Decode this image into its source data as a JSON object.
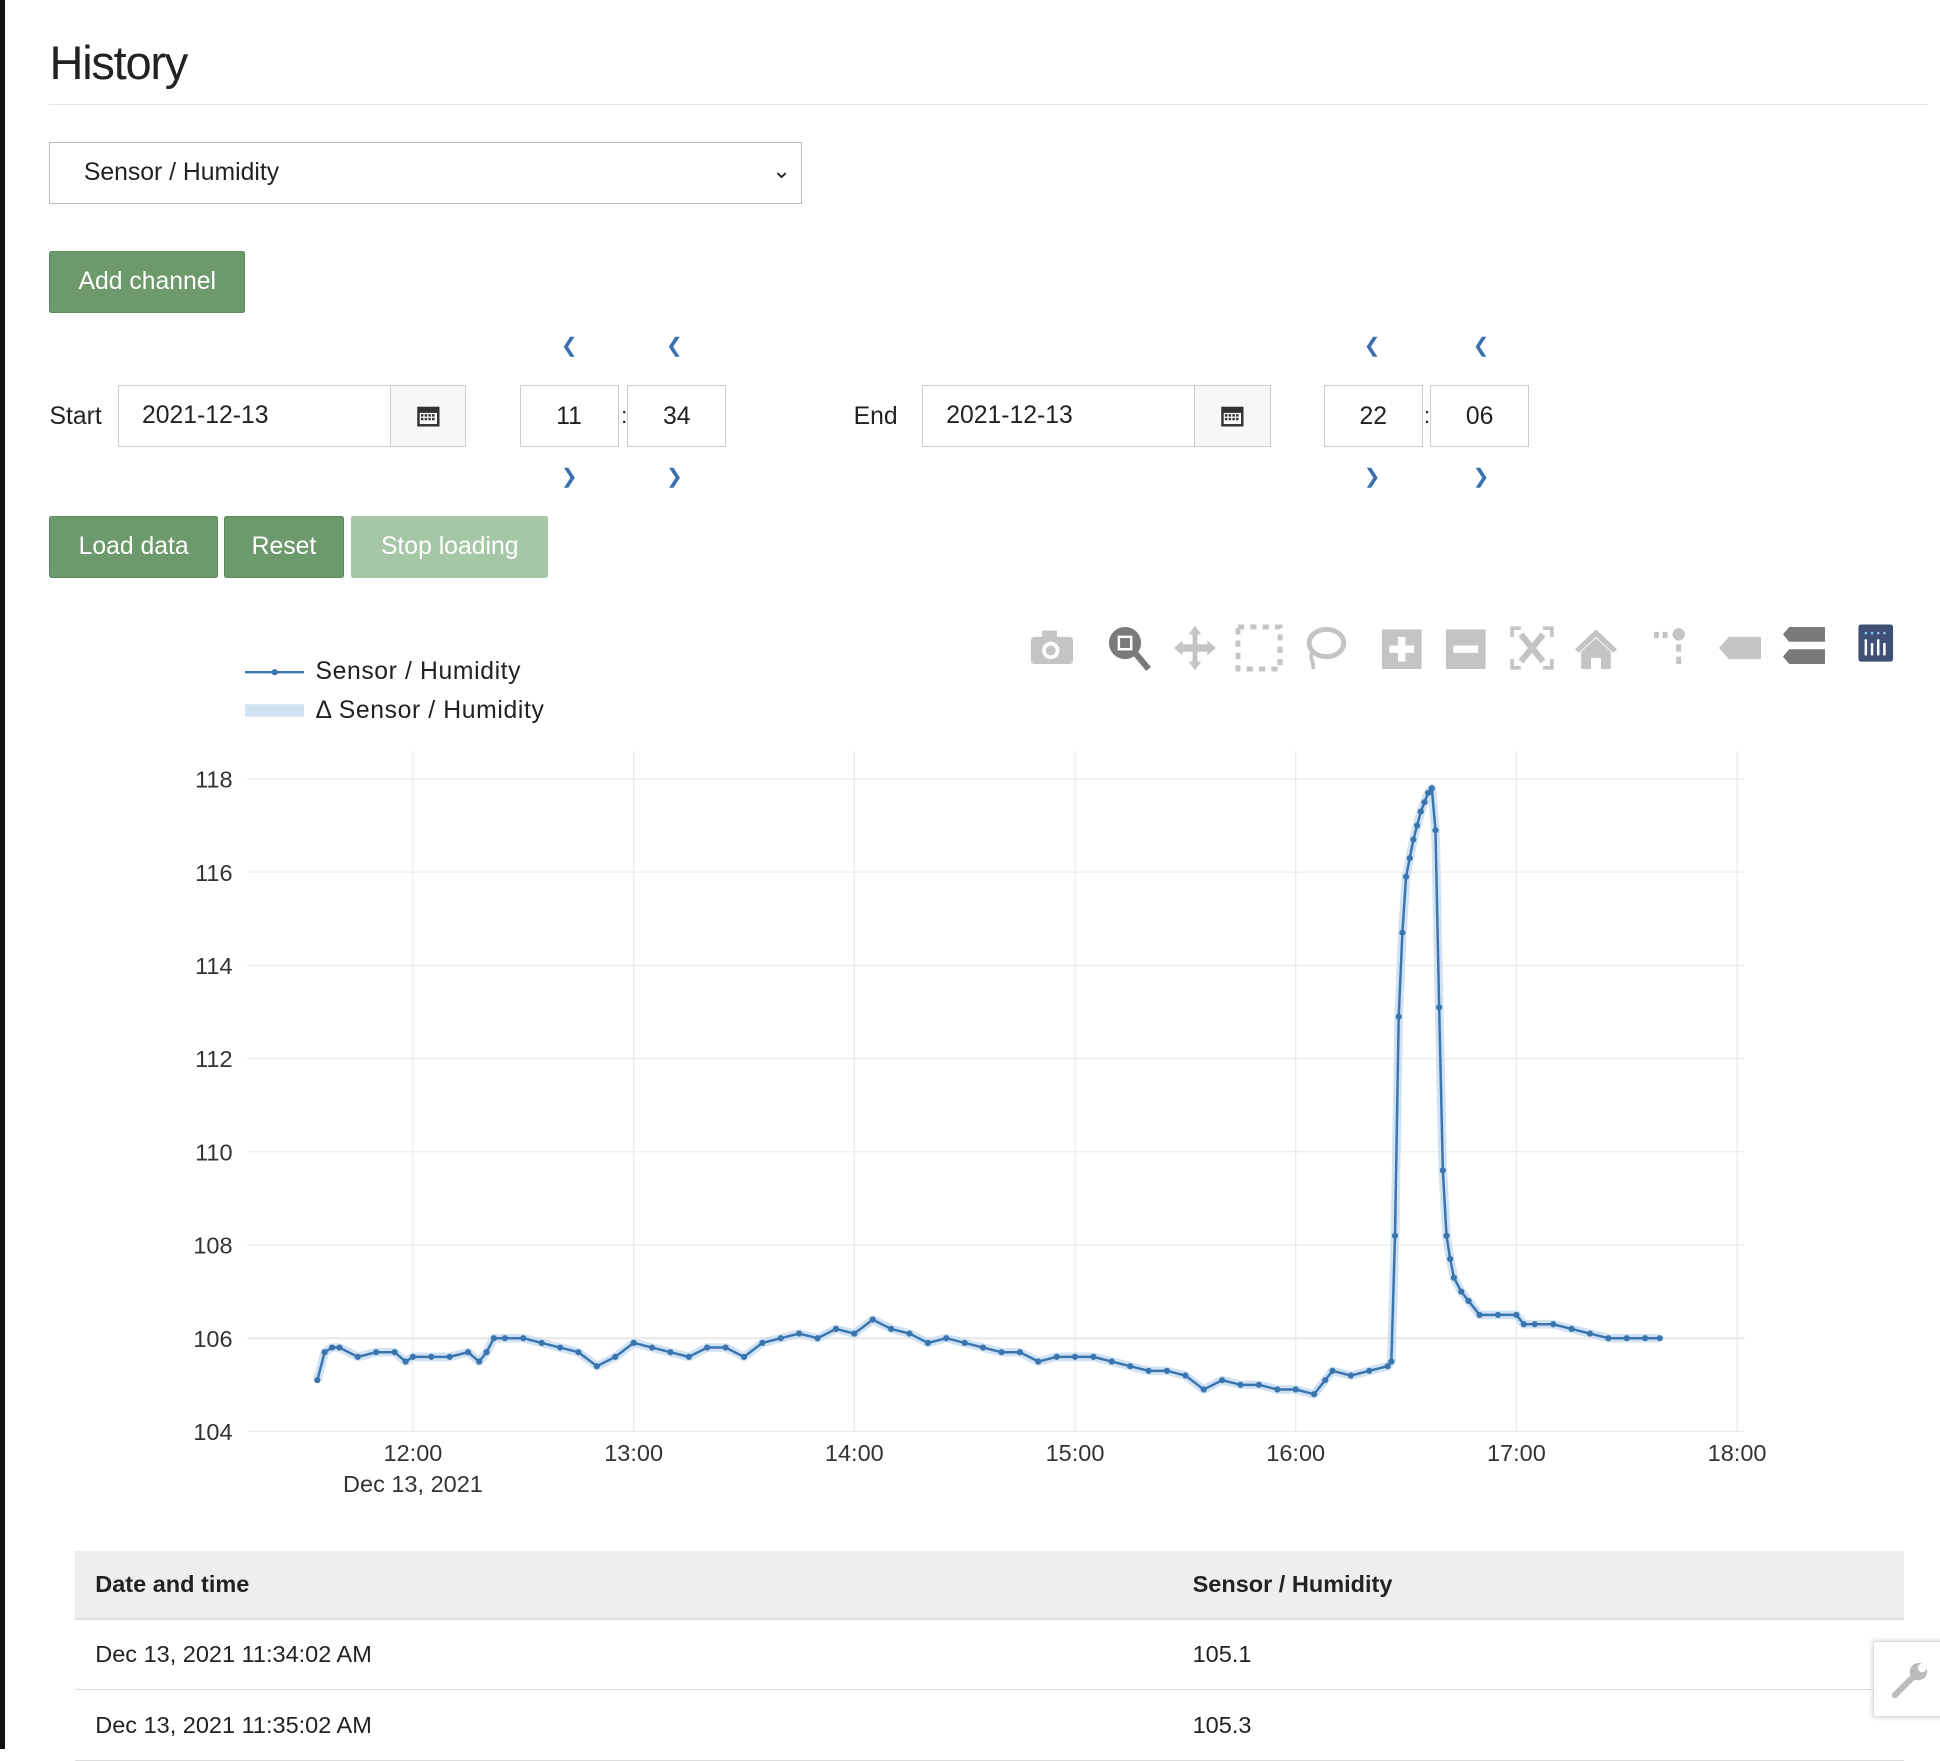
{
  "page": {
    "title": "History"
  },
  "channel_select": {
    "value": "Sensor / Humidity"
  },
  "buttons": {
    "add_channel": "Add channel",
    "load_data": "Load data",
    "reset": "Reset",
    "stop_loading": "Stop loading"
  },
  "range": {
    "start_label": "Start",
    "start_date": "2021-12-13",
    "start_hour": "11",
    "start_minute": "34",
    "end_label": "End",
    "end_date": "2021-12-13",
    "end_hour": "22",
    "end_minute": "06",
    "separator": ":"
  },
  "toolbar": [
    "camera-icon",
    "zoom-icon",
    "pan-icon",
    "box-select-icon",
    "lasso-select-icon",
    "zoom-in-icon",
    "zoom-out-icon",
    "autoscale-icon",
    "reset-axes-icon",
    "spike-lines-icon",
    "hover-closest-icon",
    "hover-compare-icon",
    "plotly-logo-icon"
  ],
  "colors": {
    "accent": "#3a75b0",
    "button": "#6c9a6c",
    "band": "#c6dbef"
  },
  "chart_data": {
    "type": "line",
    "legend": [
      "Sensor / Humidity",
      "Δ Sensor / Humidity"
    ],
    "legend_position": "top-left",
    "xlim": [
      "11:15",
      "18:02"
    ],
    "x_ticks": [
      "12:00",
      "13:00",
      "14:00",
      "15:00",
      "16:00",
      "17:00",
      "18:00"
    ],
    "x_date_label": "Dec 13, 2021",
    "ylim": [
      104,
      118.6
    ],
    "y_ticks": [
      104,
      106,
      108,
      110,
      112,
      114,
      116,
      118
    ],
    "grid": true,
    "series": [
      {
        "name": "Sensor / Humidity",
        "points": [
          [
            "11:34",
            105.1
          ],
          [
            "11:36",
            105.7
          ],
          [
            "11:38",
            105.8
          ],
          [
            "11:40",
            105.8
          ],
          [
            "11:45",
            105.6
          ],
          [
            "11:50",
            105.7
          ],
          [
            "11:55",
            105.7
          ],
          [
            "11:58",
            105.5
          ],
          [
            "12:00",
            105.6
          ],
          [
            "12:05",
            105.6
          ],
          [
            "12:10",
            105.6
          ],
          [
            "12:15",
            105.7
          ],
          [
            "12:18",
            105.5
          ],
          [
            "12:20",
            105.7
          ],
          [
            "12:22",
            106.0
          ],
          [
            "12:25",
            106.0
          ],
          [
            "12:30",
            106.0
          ],
          [
            "12:35",
            105.9
          ],
          [
            "12:40",
            105.8
          ],
          [
            "12:45",
            105.7
          ],
          [
            "12:50",
            105.4
          ],
          [
            "12:55",
            105.6
          ],
          [
            "13:00",
            105.9
          ],
          [
            "13:05",
            105.8
          ],
          [
            "13:10",
            105.7
          ],
          [
            "13:15",
            105.6
          ],
          [
            "13:20",
            105.8
          ],
          [
            "13:25",
            105.8
          ],
          [
            "13:30",
            105.6
          ],
          [
            "13:35",
            105.9
          ],
          [
            "13:40",
            106.0
          ],
          [
            "13:45",
            106.1
          ],
          [
            "13:50",
            106.0
          ],
          [
            "13:55",
            106.2
          ],
          [
            "14:00",
            106.1
          ],
          [
            "14:05",
            106.4
          ],
          [
            "14:10",
            106.2
          ],
          [
            "14:15",
            106.1
          ],
          [
            "14:20",
            105.9
          ],
          [
            "14:25",
            106.0
          ],
          [
            "14:30",
            105.9
          ],
          [
            "14:35",
            105.8
          ],
          [
            "14:40",
            105.7
          ],
          [
            "14:45",
            105.7
          ],
          [
            "14:50",
            105.5
          ],
          [
            "14:55",
            105.6
          ],
          [
            "15:00",
            105.6
          ],
          [
            "15:05",
            105.6
          ],
          [
            "15:10",
            105.5
          ],
          [
            "15:15",
            105.4
          ],
          [
            "15:20",
            105.3
          ],
          [
            "15:25",
            105.3
          ],
          [
            "15:30",
            105.2
          ],
          [
            "15:35",
            104.9
          ],
          [
            "15:40",
            105.1
          ],
          [
            "15:45",
            105.0
          ],
          [
            "15:50",
            105.0
          ],
          [
            "15:55",
            104.9
          ],
          [
            "16:00",
            104.9
          ],
          [
            "16:05",
            104.8
          ],
          [
            "16:08",
            105.1
          ],
          [
            "16:10",
            105.3
          ],
          [
            "16:15",
            105.2
          ],
          [
            "16:20",
            105.3
          ],
          [
            "16:25",
            105.4
          ],
          [
            "16:26",
            105.5
          ],
          [
            "16:27",
            108.2
          ],
          [
            "16:28",
            112.9
          ],
          [
            "16:29",
            114.7
          ],
          [
            "16:30",
            115.9
          ],
          [
            "16:31",
            116.3
          ],
          [
            "16:32",
            116.7
          ],
          [
            "16:33",
            117.0
          ],
          [
            "16:34",
            117.3
          ],
          [
            "16:35",
            117.5
          ],
          [
            "16:36",
            117.7
          ],
          [
            "16:37",
            117.8
          ],
          [
            "16:38",
            116.9
          ],
          [
            "16:39",
            113.1
          ],
          [
            "16:40",
            109.6
          ],
          [
            "16:41",
            108.2
          ],
          [
            "16:42",
            107.7
          ],
          [
            "16:43",
            107.3
          ],
          [
            "16:45",
            107.0
          ],
          [
            "16:47",
            106.8
          ],
          [
            "16:50",
            106.5
          ],
          [
            "16:55",
            106.5
          ],
          [
            "17:00",
            106.5
          ],
          [
            "17:02",
            106.3
          ],
          [
            "17:05",
            106.3
          ],
          [
            "17:10",
            106.3
          ],
          [
            "17:15",
            106.2
          ],
          [
            "17:20",
            106.1
          ],
          [
            "17:25",
            106.0
          ],
          [
            "17:30",
            106.0
          ],
          [
            "17:35",
            106.0
          ],
          [
            "17:39",
            106.0
          ]
        ]
      }
    ]
  },
  "table": {
    "headers": [
      "Date and time",
      "Sensor / Humidity"
    ],
    "rows": [
      [
        "Dec 13, 2021 11:34:02 AM",
        "105.1"
      ],
      [
        "Dec 13, 2021 11:35:02 AM",
        "105.3"
      ]
    ]
  }
}
